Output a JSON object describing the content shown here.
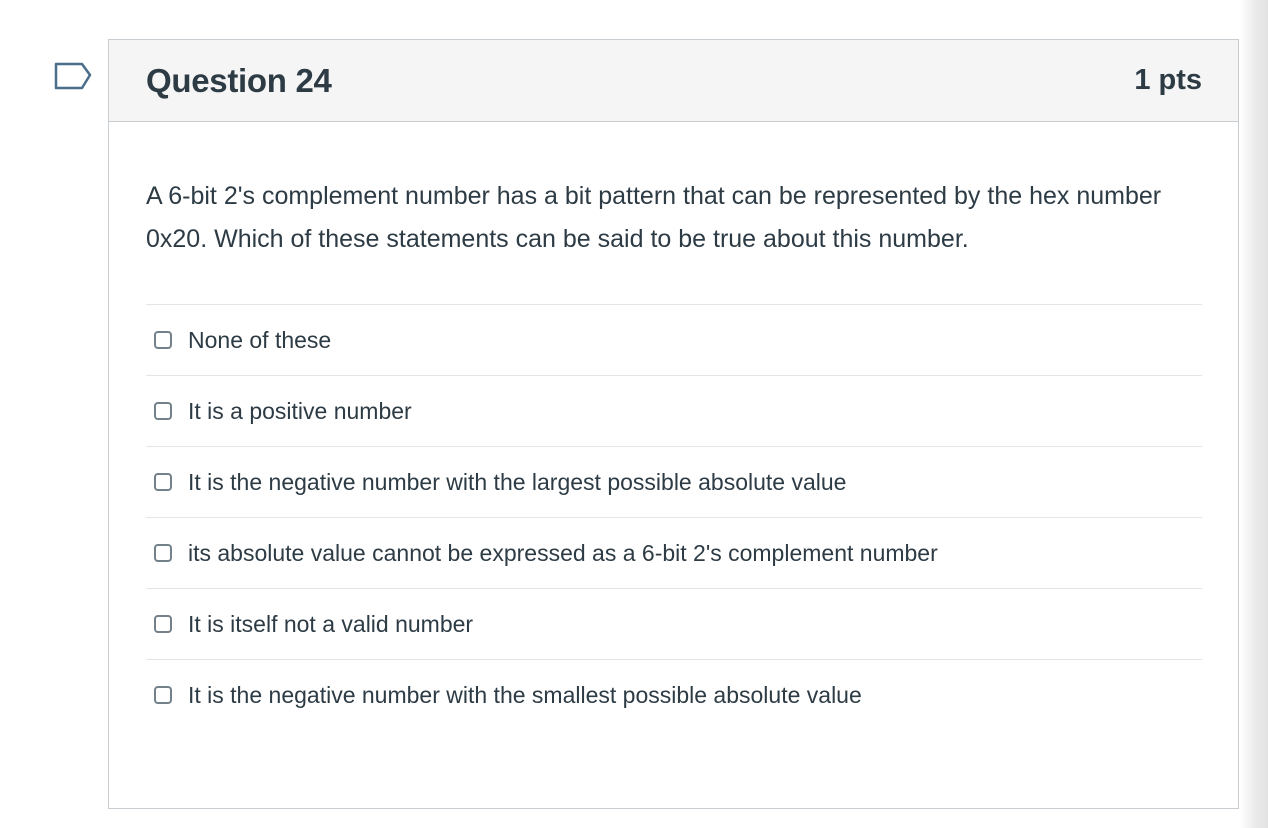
{
  "question": {
    "title": "Question 24",
    "points": "1 pts",
    "text": "A 6-bit 2's complement number has a bit pattern that can be represented by the hex number 0x20.  Which of these statements can be said to be true about this number.",
    "answers": [
      {
        "label": "None of these",
        "checked": false
      },
      {
        "label": "It is a positive number",
        "checked": false
      },
      {
        "label": "It is the negative number with the largest possible absolute value",
        "checked": false
      },
      {
        "label": "its absolute value cannot be expressed as a 6-bit 2's complement number",
        "checked": false
      },
      {
        "label": "It is itself not a valid number",
        "checked": false
      },
      {
        "label": "It is the negative number with the smallest possible absolute value",
        "checked": false
      }
    ]
  },
  "icons": {
    "flag": "flag-question-icon",
    "checkbox": "checkbox-unchecked-icon"
  },
  "colors": {
    "text": "#2d3b45",
    "header_bg": "#f5f5f5",
    "border": "#c7cdd1",
    "flag_stroke": "#4a6d8c"
  }
}
